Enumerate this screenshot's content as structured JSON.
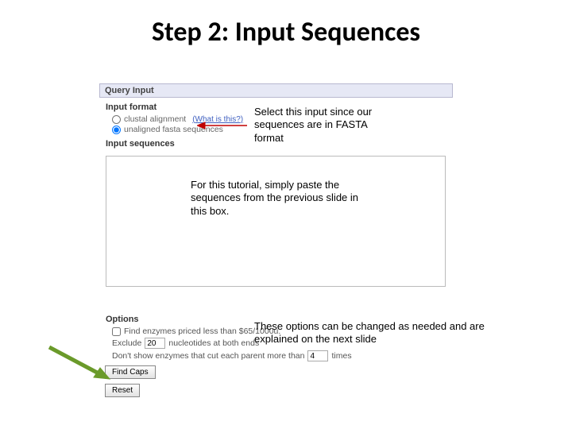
{
  "title": "Step 2: Input Sequences",
  "form": {
    "query_header": "Query Input",
    "input_format_label": "Input format",
    "radio1": "clustal alignment",
    "radio1_hint": "(What is this?)",
    "radio2": "unaligned fasta sequences",
    "input_sequences_label": "Input sequences",
    "options_label": "Options",
    "opt_price": "Find enzymes priced less than $65/1000u.",
    "opt_exclude_pre": "Exclude",
    "opt_exclude_val": "20",
    "opt_exclude_post": "nucleotides at both ends",
    "opt_cut_pre": "Don't show enzymes that cut each parent more than",
    "opt_cut_val": "4",
    "opt_cut_post": "times",
    "btn_find": "Find Caps",
    "btn_reset": "Reset"
  },
  "callouts": {
    "c1": "Select this input since our sequences are in FASTA format",
    "c2": "For this tutorial, simply paste the sequences from the previous slide in this box.",
    "c3": "These options can be changed as needed and are explained on the next slide"
  }
}
